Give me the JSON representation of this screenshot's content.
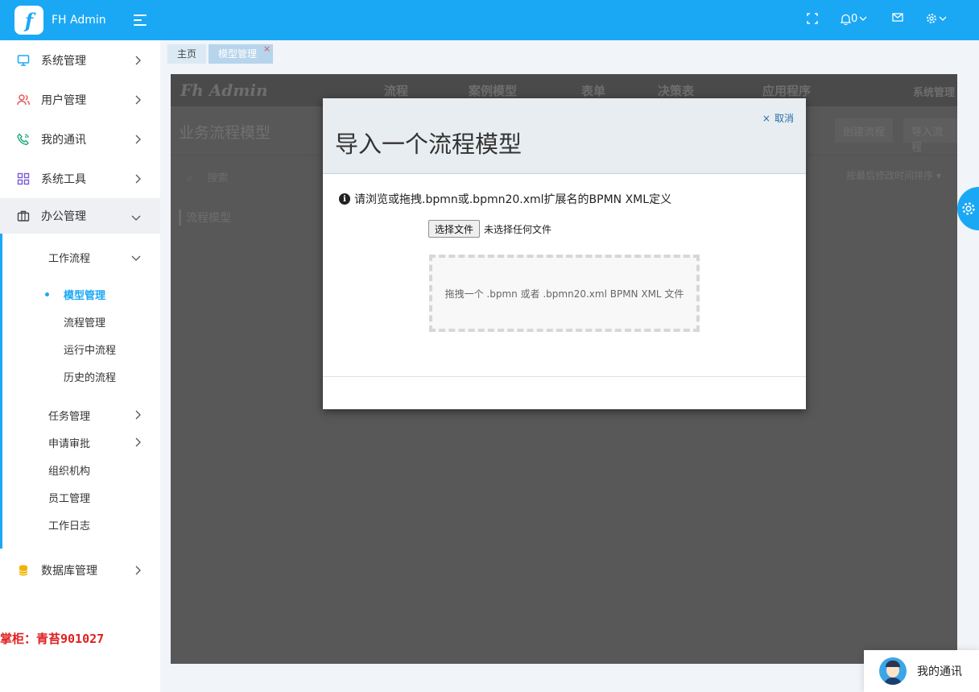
{
  "brand": {
    "title": "FH Admin",
    "logo_letter": "f"
  },
  "sidebar": {
    "items": [
      {
        "label": "系统管理",
        "icon": "monitor-icon"
      },
      {
        "label": "用户管理",
        "icon": "users-icon"
      },
      {
        "label": "我的通讯",
        "icon": "phone-icon"
      },
      {
        "label": "系统工具",
        "icon": "grid-icon"
      },
      {
        "label": "办公管理",
        "icon": "briefcase-icon"
      },
      {
        "label": "数据库管理",
        "icon": "database-icon"
      }
    ],
    "office_sub": {
      "workflow": "工作流程",
      "workflow_children": [
        "模型管理",
        "流程管理",
        "运行中流程",
        "历史的流程"
      ],
      "others": [
        "任务管理",
        "申请审批",
        "组织机构",
        "员工管理",
        "工作日志"
      ]
    },
    "promo": "掌柜：青苔901027"
  },
  "topbar": {
    "notification_count": "0"
  },
  "tabs": [
    {
      "label": "主页"
    },
    {
      "label": "模型管理",
      "close": "×"
    }
  ],
  "background_app": {
    "logo": "Fh Admin",
    "nav": [
      "流程",
      "案例模型",
      "表单",
      "决策表",
      "应用程序"
    ],
    "nav_right": "系统管理",
    "title": "业务流程模型",
    "buttons": [
      "创建流程",
      "导入流程"
    ],
    "search_placeholder": "搜索",
    "left_item": "流程模型",
    "sort": "按最后修改时间排序 ▾"
  },
  "modal": {
    "title": "导入一个流程模型",
    "cancel": "取消",
    "cancel_x": "×",
    "hint": "请浏览或拖拽.bpmn或.bpmn20.xml扩展名的BPMN XML定义",
    "file_button": "选择文件",
    "file_status": "未选择任何文件",
    "dropzone_text": "拖拽一个 .bpmn 或者 .bpmn20.xml BPMN XML 文件"
  },
  "chat": {
    "label": "我的通讯"
  },
  "colors": {
    "accent": "#1aa8f5",
    "overlay": "#585858",
    "promo": "#e02020"
  }
}
